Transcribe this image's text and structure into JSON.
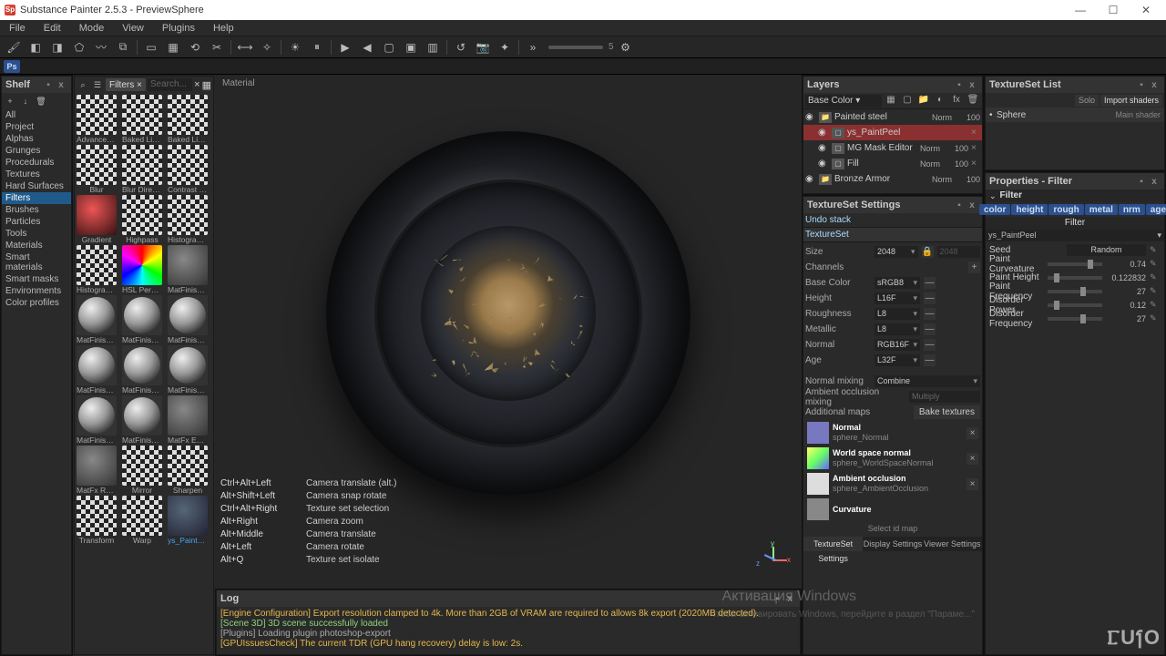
{
  "window": {
    "title": "Substance Painter 2.5.3 - PreviewSphere"
  },
  "menu": [
    "File",
    "Edit",
    "Mode",
    "View",
    "Plugins",
    "Help"
  ],
  "shelf": {
    "title": "Shelf",
    "categories": [
      "All",
      "Project",
      "Alphas",
      "Grunges",
      "Procedurals",
      "Textures",
      "Hard Surfaces",
      "Filters",
      "Brushes",
      "Particles",
      "Tools",
      "Materials",
      "Smart materials",
      "Smart masks",
      "Environments",
      "Color profiles"
    ],
    "selected": "Filters",
    "filter_chip": "Filters",
    "search_placeholder": "Search...",
    "items": [
      [
        "Advanced Tr...",
        "Baked Light...",
        "Baked Lighti..."
      ],
      [
        "Blur",
        "Blur Directi...",
        "Contrast Lu..."
      ],
      [
        "Gradient",
        "Highpass",
        "Histogram s..."
      ],
      [
        "Histogram s...",
        "HSL Percept...",
        "MatFinish G..."
      ],
      [
        "MatFinish Br...",
        "MatFinish G...",
        "MatFinish Ir..."
      ],
      [
        "MatFinish R...",
        "MatFinish R...",
        "MatFinish R..."
      ],
      [
        "MatFinish R...",
        "MatFinish R...",
        "MatFx Edge..."
      ],
      [
        "MatFx Rust ...",
        "Mirror",
        "Sharpen"
      ],
      [
        "Transform",
        "Warp",
        "ys_PaintPeel"
      ]
    ],
    "selected_item": "ys_PaintPeel"
  },
  "viewport": {
    "label": "Material",
    "help": [
      [
        "Ctrl+Alt+Left",
        "Camera translate (alt.)"
      ],
      [
        "Alt+Shift+Left",
        "Camera snap rotate"
      ],
      [
        "Ctrl+Alt+Right",
        "Texture set selection"
      ],
      [
        "Alt+Right",
        "Camera zoom"
      ],
      [
        "Alt+Middle",
        "Camera translate"
      ],
      [
        "Alt+Left",
        "Camera rotate"
      ],
      [
        "",
        ""
      ],
      [
        "Alt+Q",
        "Texture set isolate"
      ]
    ],
    "gizmo": {
      "x": "x",
      "y": "y",
      "z": "z"
    }
  },
  "log": {
    "title": "Log",
    "lines": [
      {
        "cls": "log-warn",
        "t": "[Engine Configuration] Export resolution clamped to 4k. More than 2GB of VRAM are required to allows 8k export (2020MB detected)."
      },
      {
        "cls": "log-info",
        "t": "[Scene 3D] 3D scene successfully loaded"
      },
      {
        "cls": "log-info2",
        "t": "[Plugins] Loading plugin photoshop-export"
      },
      {
        "cls": "log-warn",
        "t": "[GPUIssuesCheck] The current TDR (GPU hang recovery) delay is low: 2s."
      }
    ]
  },
  "layers": {
    "title": "Layers",
    "mode": "Base Color",
    "rows": [
      {
        "type": "folder",
        "name": "Painted steel",
        "blend": "Norm",
        "opac": "100",
        "indent": 0
      },
      {
        "type": "fill",
        "name": "ys_PaintPeel",
        "blend": "",
        "opac": "",
        "indent": 1,
        "sel": true
      },
      {
        "type": "layer",
        "name": "MG Mask Editor",
        "blend": "Norm",
        "opac": "100",
        "indent": 1
      },
      {
        "type": "fill",
        "name": "Fill",
        "blend": "Norm",
        "opac": "100",
        "indent": 1
      },
      {
        "type": "folder",
        "name": "Bronze Armor",
        "blend": "Norm",
        "opac": "100",
        "indent": 0
      }
    ]
  },
  "texset": {
    "title": "TextureSet Settings",
    "undo": "Undo stack",
    "section": "TextureSet",
    "size_label": "Size",
    "size": "2048",
    "size2": "2048",
    "channels": "Channels",
    "chs": [
      {
        "n": "Base Color",
        "v": "sRGB8"
      },
      {
        "n": "Height",
        "v": "L16F"
      },
      {
        "n": "Roughness",
        "v": "L8"
      },
      {
        "n": "Metallic",
        "v": "L8"
      },
      {
        "n": "Normal",
        "v": "RGB16F"
      },
      {
        "n": "Age",
        "v": "L32F"
      }
    ],
    "nm_label": "Normal mixing",
    "nm_val": "Combine",
    "ao_label": "Ambient occlusion mixing",
    "ao_val": "Multiply",
    "addmaps": "Additional maps",
    "bake": "Bake textures",
    "maps": [
      {
        "n": "Normal",
        "f": "sphere_Normal",
        "c": "#7878c0"
      },
      {
        "n": "World space normal",
        "f": "sphere_WorldSpaceNormal",
        "c": "linear-gradient(135deg,#ff6,#6f6,#66f)"
      },
      {
        "n": "Ambient occlusion",
        "f": "sphere_AmbientOcclusion",
        "c": "#ddd"
      },
      {
        "n": "Curvature",
        "f": "",
        "c": "#888"
      }
    ],
    "selectid": "Select id map",
    "tabs": [
      "TextureSet Settings",
      "Display Settings",
      "Viewer Settings"
    ]
  },
  "tslist": {
    "title": "TextureSet List",
    "solo": "Solo",
    "import": "Import shaders",
    "row": {
      "name": "Sphere",
      "shader": "Main shader"
    }
  },
  "props": {
    "title": "Properties - Filter",
    "header": "Filter",
    "tabs": [
      "color",
      "height",
      "rough",
      "metal",
      "nrm",
      "age"
    ],
    "sub": "Filter",
    "subname": "ys_PaintPeel",
    "seed": "Seed",
    "random": "Random",
    "params": [
      {
        "n": "Paint Curveature",
        "v": "0.74",
        "k": 74
      },
      {
        "n": "Paint Height",
        "v": "0.122832",
        "k": 12
      },
      {
        "n": "Paint Frequency",
        "v": "27",
        "k": 60
      },
      {
        "n": "Disorder Power",
        "v": "0.12",
        "k": 12
      },
      {
        "n": "Disorder Frequency",
        "v": "27",
        "k": 60
      }
    ]
  },
  "watermark": "Активация Windows",
  "watermark2": "Чтобы активировать Windows, перейдите в раздел \"Параме...\""
}
